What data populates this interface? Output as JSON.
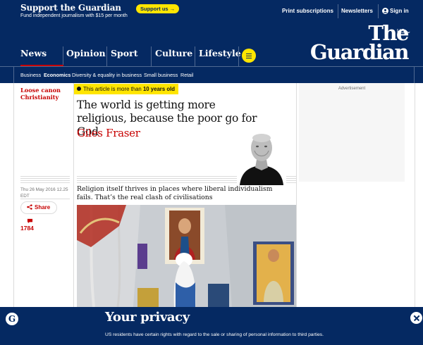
{
  "support": {
    "title": "Support the Guardian",
    "subtitle": "Fund independent journalism with $15 per month",
    "button_label": "Support us →"
  },
  "top_links": {
    "print": "Print subscriptions",
    "newsletters": "Newsletters",
    "signin": "Sign in"
  },
  "edition": "US",
  "logo": {
    "line1": "The",
    "line2": "Guardian"
  },
  "pillars": [
    "News",
    "Opinion",
    "Sport",
    "Culture",
    "Lifestyle"
  ],
  "subnav": [
    "Business",
    "Economics",
    "Diversity & equality in business",
    "Small business",
    "Retail"
  ],
  "article": {
    "series": [
      "Loose canon",
      "Christianity"
    ],
    "age_badge_prefix": "This article is more than ",
    "age_badge_bold": "10 years old",
    "headline": "The world is getting more religious, because the poor go for God",
    "byline": "Giles Fraser",
    "standfirst": "Religion itself thrives in places where liberal individualism fails. That’s the real clash of civilisations",
    "date": "Thu 26 May 2016 12.25",
    "tz": "EDT",
    "share_label": "Share",
    "comments_count": "1784"
  },
  "ad": {
    "label": "Advertisement"
  },
  "privacy": {
    "title": "Your privacy",
    "text": "US residents have certain rights with regard to the sale or sharing of personal information to third parties.",
    "logo_glyph": "G"
  },
  "colors": {
    "brand_blue": "#052962",
    "accent_yellow": "#ffe500",
    "news_red": "#c70000"
  }
}
